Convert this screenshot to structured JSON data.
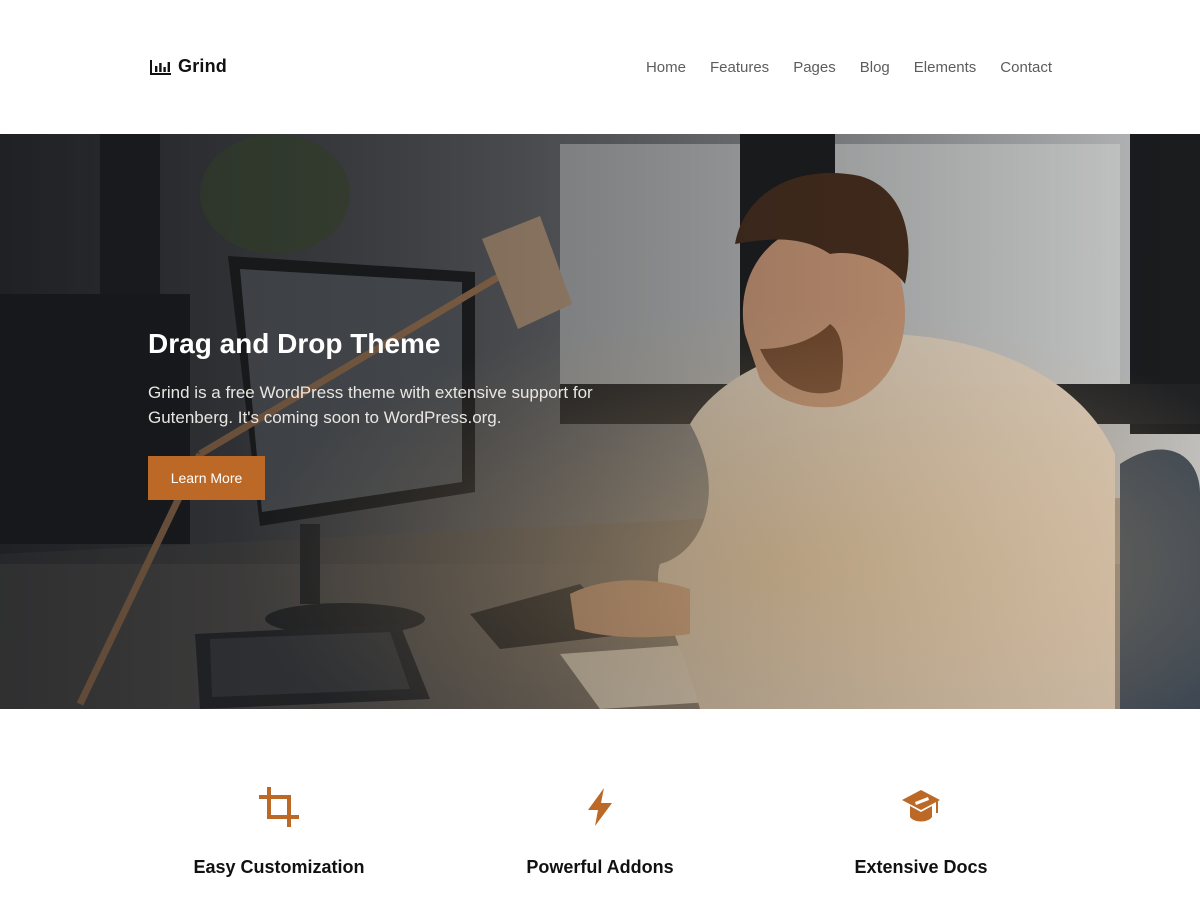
{
  "header": {
    "brand": {
      "name": "Grind",
      "icon": "bar-chart-icon"
    },
    "nav": [
      {
        "label": "Home"
      },
      {
        "label": "Features"
      },
      {
        "label": "Pages"
      },
      {
        "label": "Blog"
      },
      {
        "label": "Elements"
      },
      {
        "label": "Contact"
      }
    ]
  },
  "hero": {
    "title": "Drag and Drop Theme",
    "description": "Grind is a free WordPress theme with extensive support for Gutenberg. It's coming soon to WordPress.org.",
    "button_label": "Learn More"
  },
  "features": [
    {
      "icon": "crop-icon",
      "title": "Easy Customization"
    },
    {
      "icon": "lightning-icon",
      "title": "Powerful Addons"
    },
    {
      "icon": "graduation-cap-icon",
      "title": "Extensive Docs"
    }
  ],
  "colors": {
    "accent": "#bc6827",
    "nav_text": "#5d5d5d",
    "heading": "#111111"
  }
}
